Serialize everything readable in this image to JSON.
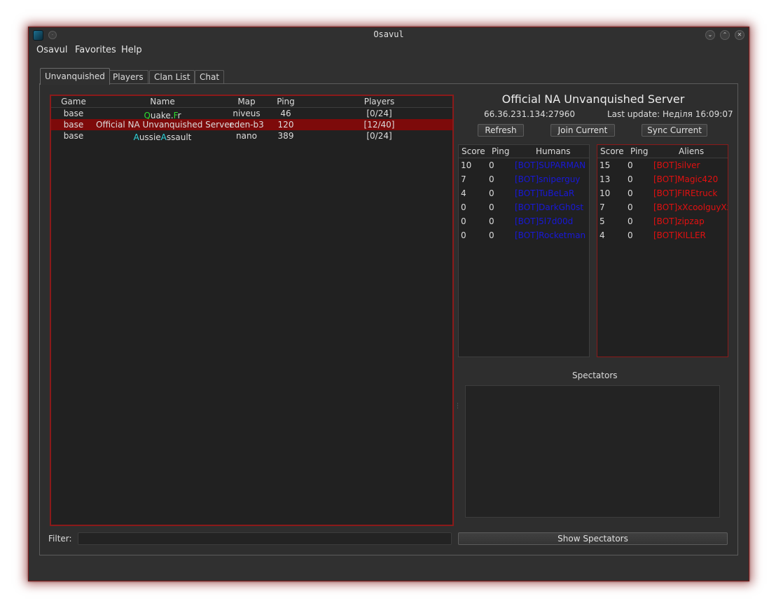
{
  "window": {
    "title": "Osavul",
    "pin_glyph": "·",
    "minimize_glyph": "⌄",
    "maximize_glyph": "⌃",
    "close_glyph": "✕"
  },
  "menu": [
    "Osavul",
    "Favorites",
    "Help"
  ],
  "tabs": [
    {
      "label": "Unvanquished",
      "active": true
    },
    {
      "label": "Players",
      "active": false
    },
    {
      "label": "Clan List",
      "active": false
    },
    {
      "label": "Chat",
      "active": false
    }
  ],
  "server_list": {
    "columns": [
      "Game",
      "Name",
      "Map",
      "Ping",
      "Players"
    ],
    "rows": [
      {
        "game": "base",
        "name_parts": [
          "Q",
          "uake.",
          "F",
          "r"
        ],
        "map": "niveus",
        "ping": "46",
        "players": "[0/24]",
        "selected": false
      },
      {
        "game": "base",
        "name": "Official NA Unvanquished Server",
        "map": "eden-b3",
        "ping": "120",
        "players": "[12/40]",
        "selected": true
      },
      {
        "game": "base",
        "name_parts": [
          "A",
          "ussie",
          "A",
          "ssault"
        ],
        "map": "nano",
        "ping": "389",
        "players": "[0/24]",
        "selected": false
      }
    ]
  },
  "server_info": {
    "title": "Official NA Unvanquished Server",
    "address": "66.36.231.134:27960",
    "last_update": "Last update: Неділя 16:09:07"
  },
  "buttons": {
    "refresh": "Refresh",
    "join": "Join Current",
    "sync": "Sync Current",
    "show_spectators": "Show Spectators"
  },
  "humans": {
    "columns": [
      "Score",
      "Ping",
      "Humans"
    ],
    "rows": [
      {
        "score": "10",
        "ping": "0",
        "name": "[BOT]SUPARMAN"
      },
      {
        "score": "7",
        "ping": "0",
        "name": "[BOT]sniperguy"
      },
      {
        "score": "4",
        "ping": "0",
        "name": "[BOT]TuBeLaR"
      },
      {
        "score": "0",
        "ping": "0",
        "name": "[BOT]DarkGh0st"
      },
      {
        "score": "0",
        "ping": "0",
        "name": "[BOT]5l7d00d"
      },
      {
        "score": "0",
        "ping": "0",
        "name": "[BOT]Rocketman"
      }
    ]
  },
  "aliens": {
    "columns": [
      "Score",
      "Ping",
      "Aliens"
    ],
    "rows": [
      {
        "score": "15",
        "ping": "0",
        "name": "[BOT]silver"
      },
      {
        "score": "13",
        "ping": "0",
        "name": "[BOT]Magic420"
      },
      {
        "score": "10",
        "ping": "0",
        "name": "[BOT]FIREtruck"
      },
      {
        "score": "7",
        "ping": "0",
        "name": "[BOT]xXcoolguyXx"
      },
      {
        "score": "5",
        "ping": "0",
        "name": "[BOT]zipzap"
      },
      {
        "score": "4",
        "ping": "0",
        "name": "[BOT]KILLER"
      }
    ]
  },
  "spectators_label": "Spectators",
  "filter_label": "Filter:",
  "colors": {
    "selection": "#7d0a0a",
    "frame_accent": "#8b1a1a",
    "humans_text": "#1818d8",
    "aliens_text": "#e21010",
    "color_code_green": "#2fdc2f",
    "color_code_cyan": "#2fd9e0"
  }
}
